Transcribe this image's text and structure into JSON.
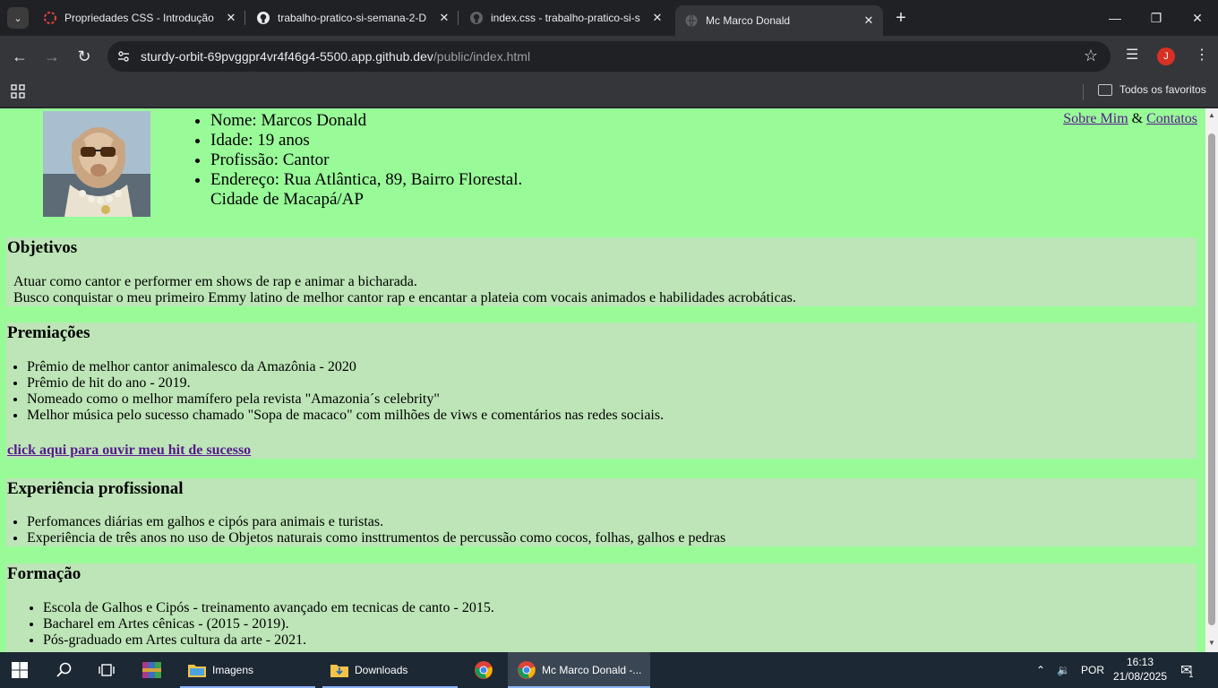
{
  "tabs": [
    {
      "label": "Propriedades CSS - Introdução",
      "favicon": "loading-ring-icon"
    },
    {
      "label": "trabalho-pratico-si-semana-2-D",
      "favicon": "github-icon"
    },
    {
      "label": "index.css - trabalho-pratico-si-s",
      "favicon": "github-icon"
    },
    {
      "label": "Mc Marco Donald",
      "favicon": "globe-icon",
      "active": true
    }
  ],
  "address": {
    "host": "sturdy-orbit-69pvggpr4vr4f46g4-5500.app.github.dev",
    "path": "/public/index.html"
  },
  "profile_initial": "J",
  "bookmarks": {
    "all_label": "Todos os favoritos"
  },
  "page": {
    "info": {
      "nome": "Nome: Marcos Donald",
      "idade": "Idade: 19 anos",
      "profissao": "Profissão: Cantor",
      "endereco_line1": "Endereço: Rua Atlântica, 89, Bairro Florestal.",
      "endereco_line2": "Cidade de Macapá/AP"
    },
    "nav": {
      "sobre": "Sobre Mim",
      "amp": "&",
      "contatos": "Contatos"
    },
    "objetivos": {
      "title": "Objetivos",
      "lines": [
        "Atuar como cantor e performer em shows de rap e animar a bicharada.",
        "Busco conquistar o meu primeiro Emmy latino de melhor cantor rap e encantar a plateia com vocais animados e habilidades acrobáticas."
      ]
    },
    "premiacoes": {
      "title": "Premiações",
      "items": [
        "Prêmio de melhor cantor animalesco da Amazônia - 2020",
        "Prêmio de hit do ano - 2019.",
        "Nomeado como o melhor mamífero pela revista \"Amazonia´s celebrity\"",
        "Melhor música pelo sucesso chamado \"Sopa de macaco\" com milhões de viws e comentários nas redes sociais."
      ],
      "link": "click aqui para ouvir meu hit de sucesso"
    },
    "experiencia": {
      "title": "Experiência profissional",
      "items": [
        "Perfomances diárias em galhos e cipós para animais e turistas.",
        "Experiência de três anos no uso de Objetos naturais como insttrumentos de percussão como cocos, folhas, galhos e pedras"
      ]
    },
    "formacao": {
      "title": "Formação",
      "items": [
        "Escola de Galhos e Cipós - treinamento avançado em tecnicas de canto - 2015.",
        "Bacharel em Artes cênicas - (2015 - 2019).",
        "Pós-graduado em Artes cultura da arte - 2021."
      ]
    }
  },
  "taskbar": {
    "apps": [
      {
        "label": "Imagens"
      },
      {
        "label": "Downloads"
      },
      {
        "label": "Mc Marco Donald -..."
      }
    ],
    "lang": "POR",
    "time": "16:13",
    "date": "21/08/2025",
    "notif_count": "1"
  },
  "colors": {
    "page_bg": "#98fb98",
    "section_bg": "#bde5b7",
    "link_visited": "#551a8b",
    "chrome_dark": "#202124",
    "chrome_toolbar": "#35363a"
  }
}
